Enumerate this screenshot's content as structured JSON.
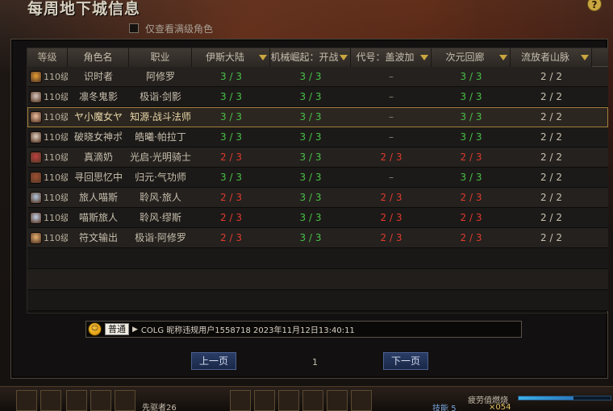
{
  "window": {
    "title": "每周地下城信息",
    "help_label": "?",
    "filter_label": "仅查看满级角色"
  },
  "table": {
    "headers": [
      "等级",
      "角色名",
      "职业",
      "伊斯大陆",
      "机械崛起：开战",
      "代号：盖波加",
      "次元回廊",
      "流放者山脉"
    ],
    "rows": [
      {
        "level": "110级",
        "name": "识时者",
        "job": "阿修罗",
        "c1": "3 / 3",
        "c2": "3 / 3",
        "c3": "–",
        "c4": "3 / 3",
        "c5": "2 / 2",
        "avatar_color": "#e8a030"
      },
      {
        "level": "110级",
        "name": "凛冬鬼影",
        "job": "极诣·剑影",
        "c1": "3 / 3",
        "c2": "3 / 3",
        "c3": "–",
        "c4": "3 / 3",
        "c5": "2 / 2",
        "avatar_color": "#d8c8c0"
      },
      {
        "level": "110级",
        "name": "ヤ小魔女ヤ",
        "job": "知源·战斗法师",
        "c1": "3 / 3",
        "c2": "3 / 3",
        "c3": "–",
        "c4": "3 / 3",
        "c5": "2 / 2",
        "avatar_color": "#f0c0a0"
      },
      {
        "level": "110级",
        "name": "破晓女神ポ",
        "job": "皓曦·帕拉丁",
        "c1": "3 / 3",
        "c2": "3 / 3",
        "c3": "–",
        "c4": "3 / 3",
        "c5": "2 / 2",
        "avatar_color": "#e0d0c0"
      },
      {
        "level": "110级",
        "name": "真滴奶",
        "job": "光启·光明骑士",
        "c1": "2 / 3",
        "c2": "3 / 3",
        "c3": "2 / 3",
        "c4": "2 / 3",
        "c5": "2 / 2",
        "avatar_color": "#c04040"
      },
      {
        "level": "110级",
        "name": "寻回思忆中",
        "job": "归元·气功师",
        "c1": "3 / 3",
        "c2": "3 / 3",
        "c3": "–",
        "c4": "3 / 3",
        "c5": "2 / 2",
        "avatar_color": "#a05030"
      },
      {
        "level": "110级",
        "name": "旅人喵斯",
        "job": "聆风·旅人",
        "c1": "2 / 3",
        "c2": "3 / 3",
        "c3": "2 / 3",
        "c4": "2 / 3",
        "c5": "2 / 2",
        "avatar_color": "#b0c8e0"
      },
      {
        "level": "110级",
        "name": "喵斯旅人",
        "job": "聆风·缪斯",
        "c1": "2 / 3",
        "c2": "3 / 3",
        "c3": "2 / 3",
        "c4": "2 / 3",
        "c5": "2 / 2",
        "avatar_color": "#c0d0e8"
      },
      {
        "level": "110级",
        "name": "符文输出",
        "job": "极诣·阿修罗",
        "c1": "2 / 3",
        "c2": "3 / 3",
        "c3": "2 / 3",
        "c4": "2 / 3",
        "c5": "2 / 2",
        "avatar_color": "#e8b070"
      }
    ],
    "selected_index": 2
  },
  "broadcast": {
    "tag": "普通",
    "text": "COLG 昵称违规用户1558718 2023年11月12日13:40:11"
  },
  "pager": {
    "prev_label": "上一页",
    "next_label": "下一页",
    "page": "1"
  },
  "hud": {
    "player_label": "先驱者26",
    "skill_label": "技能",
    "skill_count": "5",
    "buff_label": "疲劳值燃烧",
    "gold": "×054"
  },
  "colors": {
    "complete": "#48c048",
    "incomplete": "#e03a2e",
    "accent": "#c9a640"
  }
}
